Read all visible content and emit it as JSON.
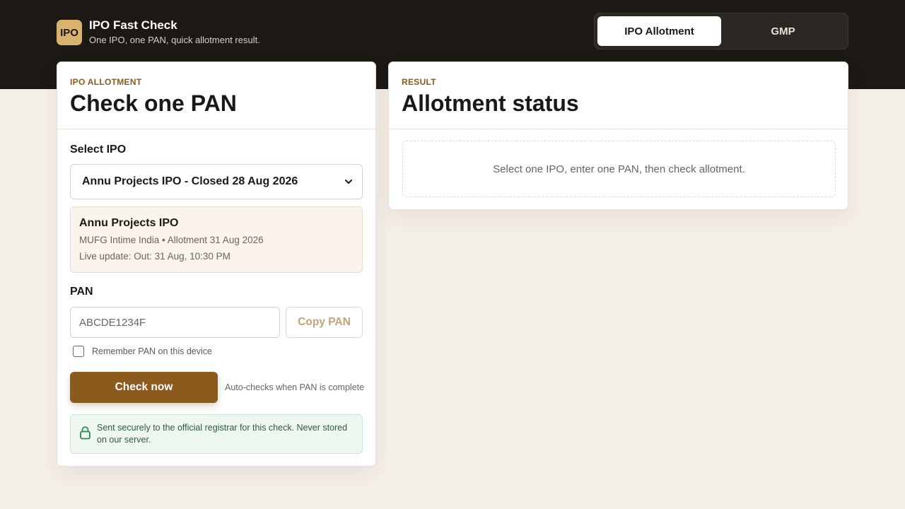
{
  "header": {
    "logo_text": "IPO",
    "title": "IPO Fast Check",
    "subtitle": "One IPO, one PAN, quick allotment result."
  },
  "tabs": [
    {
      "label": "IPO Allotment",
      "active": true
    },
    {
      "label": "GMP",
      "active": false
    }
  ],
  "left_card": {
    "eyebrow": "IPO ALLOTMENT",
    "title": "Check one PAN",
    "select_label": "Select IPO",
    "select_value": "Annu Projects IPO - Closed 28 Aug 2026",
    "ipo_info": {
      "name": "Annu Projects IPO",
      "registrar_line": "MUFG Intime India • Allotment 31 Aug 2026",
      "live_update": "Live update: Out: 31 Aug, 10:30 PM"
    },
    "pan_label": "PAN",
    "pan_placeholder": "ABCDE1234F",
    "copy_button": "Copy PAN",
    "remember_label": "Remember PAN on this device",
    "remember_checked": false,
    "check_button": "Check now",
    "auto_note": "Auto-checks when PAN is complete",
    "secure_note": "Sent securely to the official registrar for this check. Never stored on our server."
  },
  "right_card": {
    "eyebrow": "RESULT",
    "title": "Allotment status",
    "empty_message": "Select one IPO, enter one PAN, then check allotment."
  },
  "icons": {
    "chevron": "chevron-down-icon",
    "lock": "lock-icon"
  },
  "colors": {
    "header_bg": "#1c1915",
    "accent": "#8c5a1d",
    "logo_bg": "#d9b26e",
    "secure_bg": "#eef8f1"
  }
}
